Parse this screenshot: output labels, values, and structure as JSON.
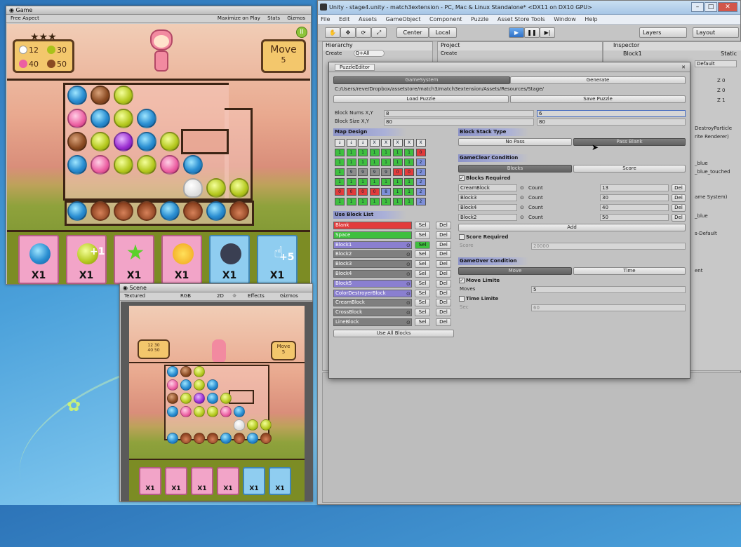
{
  "game_window": {
    "tab": "Game",
    "aspect": "Free Aspect",
    "toolbar_right": [
      "Maximize on Play",
      "Stats",
      "Gizmos"
    ],
    "goals": [
      {
        "value": "12"
      },
      {
        "value": "30"
      },
      {
        "value": "40"
      },
      {
        "value": "50"
      }
    ],
    "move_label": "Move",
    "move_value": "5",
    "items": [
      "X1",
      "X1",
      "X1",
      "X1",
      "X1",
      "X1"
    ],
    "item_badges": [
      "+1",
      "+5"
    ]
  },
  "scene_window": {
    "tab": "Scene",
    "render_mode": "Textured",
    "color_mode": "RGB",
    "mode_2d": "2D",
    "effects": "Effects",
    "gizmos": "Gizmos",
    "move_label": "Move",
    "move_value": "5",
    "goals": [
      "12",
      "30",
      "40",
      "50"
    ],
    "items": [
      "X1",
      "X1",
      "X1",
      "X1",
      "X1",
      "X1"
    ]
  },
  "unity": {
    "title": "Unity - stage4.unity - match3extension - PC, Mac & Linux Standalone* <DX11 on DX10 GPU>",
    "menu": [
      "File",
      "Edit",
      "Assets",
      "GameObject",
      "Component",
      "Puzzle",
      "Asset Store Tools",
      "Window",
      "Help"
    ],
    "center_btn": "Center",
    "local_btn": "Local",
    "layers_btn": "Layers",
    "layout_btn": "Layout",
    "hierarchy_tab": "Hierarchy",
    "hierarchy_create": "Create",
    "hierarchy_search": "Q+All",
    "project_tab": "Project",
    "project_create": "Create",
    "inspector_tab": "Inspector",
    "inspector_object": "Block1",
    "inspector_static": "Static",
    "inspector_default": "Default",
    "inspector_z": [
      "Z 0",
      "Z 0",
      "Z 1"
    ],
    "inspector_fragments": [
      "DestroyParticle",
      "rite Renderer)",
      "_blue",
      "_blue_touched",
      "ame System)",
      "_blue",
      "s-Default",
      "ent"
    ]
  },
  "puzzle_editor": {
    "title": "PuzzleEditor",
    "tabs": [
      "GameSystem",
      "Generate"
    ],
    "path": "C:/Users/reve/Dropbox/assetstore/match3/match3extension/Assets/Resources/Stage/",
    "load_btn": "Load Puzzle",
    "save_btn": "Save Puzzle",
    "block_nums_label": "Block Nums X,Y",
    "block_nums": [
      "8",
      "6"
    ],
    "block_size_label": "Block Size X,Y",
    "block_size": [
      "80",
      "80"
    ],
    "map_design_label": "Map Design",
    "arrow_row": [
      "↓",
      "↓",
      "↓",
      "X",
      "X",
      "X",
      "X",
      "X"
    ],
    "map_rows": [
      [
        {
          "v": "1",
          "c": "g"
        },
        {
          "v": "1",
          "c": "g"
        },
        {
          "v": "1",
          "c": "g"
        },
        {
          "v": "1",
          "c": "g"
        },
        {
          "v": "1",
          "c": "g"
        },
        {
          "v": "1",
          "c": "g"
        },
        {
          "v": "1",
          "c": "g"
        },
        {
          "v": "0",
          "c": "r"
        }
      ],
      [
        {
          "v": "1",
          "c": "g"
        },
        {
          "v": "1",
          "c": "g"
        },
        {
          "v": "1",
          "c": "g"
        },
        {
          "v": "1",
          "c": "g"
        },
        {
          "v": "1",
          "c": "g"
        },
        {
          "v": "1",
          "c": "g"
        },
        {
          "v": "1",
          "c": "g"
        },
        {
          "v": "2",
          "c": "b"
        }
      ],
      [
        {
          "v": "1",
          "c": "g"
        },
        {
          "v": "9",
          "c": "s"
        },
        {
          "v": "9",
          "c": "s"
        },
        {
          "v": "9",
          "c": "s"
        },
        {
          "v": "9",
          "c": "s"
        },
        {
          "v": "0",
          "c": "r"
        },
        {
          "v": "0",
          "c": "r"
        },
        {
          "v": "2",
          "c": "b"
        }
      ],
      [
        {
          "v": "1",
          "c": "g"
        },
        {
          "v": "1",
          "c": "g"
        },
        {
          "v": "1",
          "c": "g"
        },
        {
          "v": "1",
          "c": "g"
        },
        {
          "v": "1",
          "c": "g"
        },
        {
          "v": "1",
          "c": "g"
        },
        {
          "v": "1",
          "c": "g"
        },
        {
          "v": "2",
          "c": "b"
        }
      ],
      [
        {
          "v": "0",
          "c": "r"
        },
        {
          "v": "0",
          "c": "r"
        },
        {
          "v": "0",
          "c": "r"
        },
        {
          "v": "0",
          "c": "r"
        },
        {
          "v": "8",
          "c": "b"
        },
        {
          "v": "1",
          "c": "g"
        },
        {
          "v": "1",
          "c": "g"
        },
        {
          "v": "2",
          "c": "b"
        }
      ],
      [
        {
          "v": "1",
          "c": "g"
        },
        {
          "v": "1",
          "c": "g"
        },
        {
          "v": "1",
          "c": "g"
        },
        {
          "v": "1",
          "c": "g"
        },
        {
          "v": "1",
          "c": "g"
        },
        {
          "v": "1",
          "c": "g"
        },
        {
          "v": "1",
          "c": "g"
        },
        {
          "v": "2",
          "c": "b"
        }
      ]
    ],
    "use_block_list_label": "Use Block List",
    "block_list": [
      {
        "name": "Blank",
        "color": "#e23b3b",
        "selected": false
      },
      {
        "name": "Space",
        "color": "#3fbf3f",
        "selected": false
      },
      {
        "name": "Block1",
        "color": "#8a7fd0",
        "selected": true
      },
      {
        "name": "Block2",
        "color": "#7f7f7f",
        "selected": false
      },
      {
        "name": "Block3",
        "color": "#7f7f7f",
        "selected": false
      },
      {
        "name": "Block4",
        "color": "#7f7f7f",
        "selected": false
      },
      {
        "name": "Block5",
        "color": "#8a7fd0",
        "selected": false
      },
      {
        "name": "ColorDestroyerBlock",
        "color": "#8a7fd0",
        "selected": false
      },
      {
        "name": "CreamBlock",
        "color": "#7f7f7f",
        "selected": false
      },
      {
        "name": "CrossBlock",
        "color": "#7f7f7f",
        "selected": false
      },
      {
        "name": "LineBlock",
        "color": "#7f7f7f",
        "selected": false
      }
    ],
    "sel_label": "Sel",
    "del_label": "Del",
    "use_all_btn": "Use All Blocks",
    "block_stack_label": "Block Stack Type",
    "no_pass_btn": "No Pass",
    "pass_blank_btn": "Pass Blank",
    "gameclear_label": "GameClear Condition",
    "blocks_tab": "Blocks",
    "score_tab": "Score",
    "blocks_required_label": "Blocks Required",
    "count_label": "Count",
    "required": [
      {
        "block": "CreamBlock",
        "count": "13"
      },
      {
        "block": "Block3",
        "count": "30"
      },
      {
        "block": "Block4",
        "count": "40"
      },
      {
        "block": "Block2",
        "count": "50"
      }
    ],
    "add_btn": "Add",
    "score_required_label": "Score Required",
    "score_label": "Score",
    "score_value": "20000",
    "gameover_label": "GameOver Condition",
    "move_tab": "Move",
    "time_tab": "Time",
    "move_limit_label": "Move Limite",
    "moves_label": "Moves",
    "moves_value": "5",
    "time_limit_label": "Time Limite",
    "sec_label": "Sec",
    "sec_value": "60"
  }
}
